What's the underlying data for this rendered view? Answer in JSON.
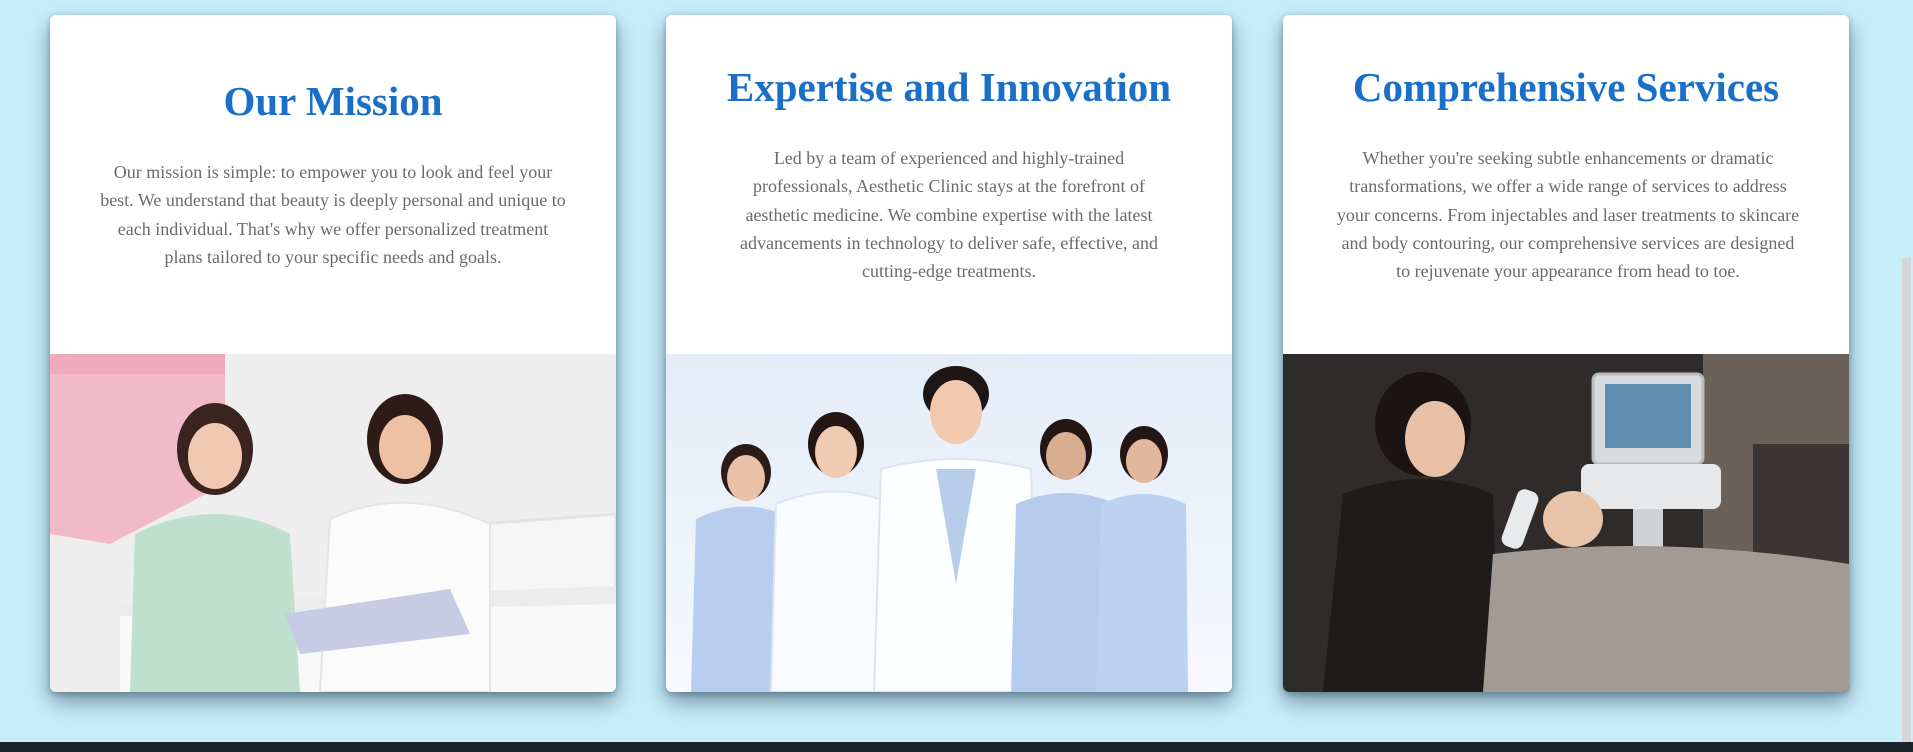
{
  "cards": [
    {
      "title": "Our Mission",
      "text": "Our mission is simple: to empower you to look and feel your best. We understand that beauty is deeply personal and unique to each individual. That's why we offer personalized treatment plans tailored to your specific needs and goals.",
      "image_subject": "consultation-photo"
    },
    {
      "title": "Expertise and Innovation",
      "text": "Led by a team of experienced and highly-trained professionals, Aesthetic Clinic stays at the forefront of aesthetic medicine. We combine expertise with the latest advancements in technology to deliver safe, effective, and cutting-edge treatments.",
      "image_subject": "medical-team-photo"
    },
    {
      "title": "Comprehensive Services",
      "text": "Whether you're seeking subtle enhancements or dramatic transformations, we offer a wide range of services to address your concerns. From injectables and laser treatments to skincare and body contouring, our comprehensive services are designed to rejuvenate your appearance from head to toe.",
      "image_subject": "facial-treatment-photo"
    }
  ],
  "colors": {
    "page_background": "#c9eefb",
    "card_background": "#ffffff",
    "title": "#1a6fc9",
    "body_text": "#6a6a6a",
    "footer": "#1b2329"
  }
}
